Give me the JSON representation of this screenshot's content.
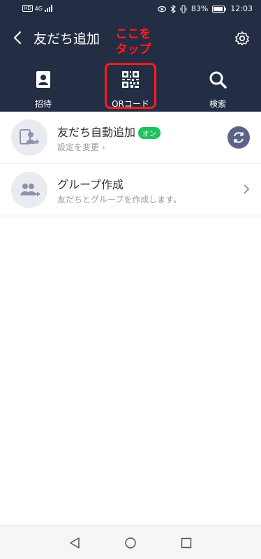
{
  "status": {
    "network": "4G",
    "battery": "83%",
    "time": "12:03"
  },
  "header": {
    "title": "友だち追加",
    "annotation_line1": "ここを",
    "annotation_line2": "タップ"
  },
  "tabs": [
    {
      "label": "招待",
      "icon": "contacts-book-icon"
    },
    {
      "label": "QRコード",
      "icon": "qr-code-icon"
    },
    {
      "label": "検索",
      "icon": "search-icon"
    }
  ],
  "list": [
    {
      "title": "友だち自動追加",
      "badge": "オン",
      "subtitle": "設定を変更 ›",
      "icon": "auto-add-icon"
    },
    {
      "title": "グループ作成",
      "subtitle": "友だちとグループを作成します。",
      "icon": "group-icon"
    }
  ],
  "colors": {
    "header_bg": "#232d44",
    "highlight": "#ff1c1c",
    "badge": "#1fc160"
  }
}
